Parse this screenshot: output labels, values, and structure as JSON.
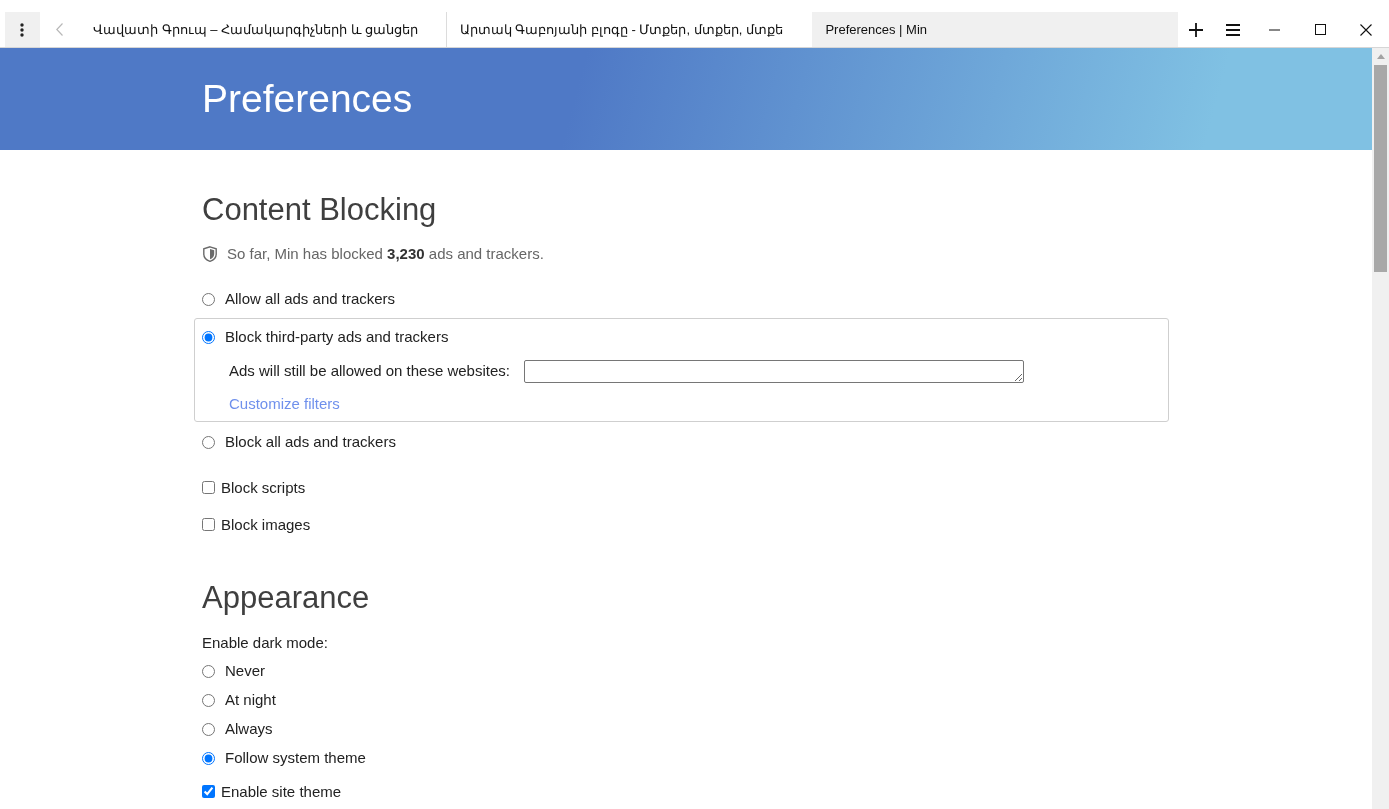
{
  "window": {
    "tabs": [
      {
        "title": "Վավատի Գրուպ – Համակարգիչների և ցանցեր",
        "selected": false
      },
      {
        "title": "Արտակ Գաբոյանի բլոգը - Մտքեր, մտքեր, մտքե",
        "selected": false
      },
      {
        "title": "Preferences | Min",
        "selected": true
      }
    ]
  },
  "header": {
    "title": "Preferences"
  },
  "content_blocking": {
    "heading": "Content Blocking",
    "stats": "So far, Min has blocked **3,230** ads and trackers.",
    "levels": [
      {
        "label": "Allow all ads and trackers",
        "selected": false
      },
      {
        "label": "Block third-party ads and trackers",
        "selected": true,
        "allowlist_label": "Ads will still be allowed on these websites:",
        "link": "Customize filters"
      },
      {
        "label": "Block all ads and trackers",
        "selected": false
      }
    ],
    "options": [
      {
        "label": "Block scripts",
        "checked": false
      },
      {
        "label": "Block images",
        "checked": false
      }
    ]
  },
  "appearance": {
    "heading": "Appearance",
    "dark_mode_label": "Enable dark mode:",
    "dark_mode_options": [
      {
        "label": "Never",
        "selected": false
      },
      {
        "label": "At night",
        "selected": false
      },
      {
        "label": "Always",
        "selected": false
      },
      {
        "label": "Follow system theme",
        "selected": true
      }
    ],
    "site_theme": {
      "label": "Enable site theme",
      "checked": true
    }
  }
}
